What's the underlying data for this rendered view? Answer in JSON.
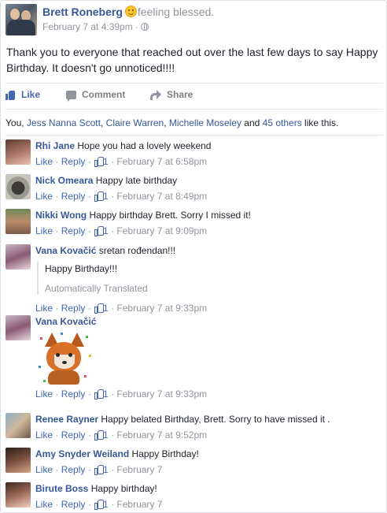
{
  "post": {
    "author": "Brett Roneberg",
    "feeling": "feeling blessed.",
    "timestamp": "February 7 at 4:39pm",
    "separator": "·",
    "text": "Thank you to everyone that reached out over the last few days to say Happy Birthday. It doesn't go unnoticed!!!!",
    "icons": {
      "feeling": "smiley-icon",
      "privacy": "globe-icon"
    }
  },
  "actions": {
    "like": "Like",
    "comment": "Comment",
    "share": "Share"
  },
  "likes": {
    "prefix": "You, ",
    "names": [
      "Jess Nanna Scott",
      "Claire Warren",
      "Michelle Moseley"
    ],
    "sep1": ", ",
    "sep2": ", ",
    "and": " and ",
    "others": "45 others",
    "suffix": " like this."
  },
  "comments": [
    {
      "name": "Rhi Jane",
      "text": "Hope you had a lovely weekend",
      "like": "Like",
      "reply": "Reply",
      "count": "1",
      "time": "February 7 at 6:58pm"
    },
    {
      "name": "Nick Omeara",
      "text": "Happy late birthday",
      "like": "Like",
      "reply": "Reply",
      "count": "1",
      "time": "February 7 at 8:49pm"
    },
    {
      "name": "Nikki Wong",
      "text": "Happy birthday Brett. Sorry I missed it!",
      "like": "Like",
      "reply": "Reply",
      "count": "1",
      "time": "February 7 at 9:09pm"
    },
    {
      "name": "Vana Kovačić",
      "text": "sretan rođendan!!!",
      "translation": "Happy Birthday!!!",
      "translation_label": "Automatically Translated",
      "like": "Like",
      "reply": "Reply",
      "count": "1",
      "time": "February 7 at 9:33pm"
    },
    {
      "name": "Vana Kovačić",
      "text": "",
      "sticker": "fox-sticker",
      "like": "Like",
      "reply": "Reply",
      "count": "1",
      "time": "February 7 at 9:33pm"
    },
    {
      "name": "Renee Rayner",
      "text": "Happy belated Birthday, Brett. Sorry to have missed it .",
      "like": "Like",
      "reply": "Reply",
      "count": "1",
      "time": "February 7 at 9:52pm"
    },
    {
      "name": "Amy Snyder Weiland",
      "text": "Happy Birthday!",
      "like": "Like",
      "reply": "Reply",
      "count": "1",
      "time": "February 7"
    },
    {
      "name": "Birute Boss",
      "text": "Happy birthday!",
      "like": "Like",
      "reply": "Reply",
      "count": "1",
      "time": "February 7"
    }
  ],
  "meta_sep": " · ",
  "colors": {
    "link": "#365899",
    "accent": "#4267b2",
    "muted": "#90949c",
    "text": "#1d2129"
  }
}
